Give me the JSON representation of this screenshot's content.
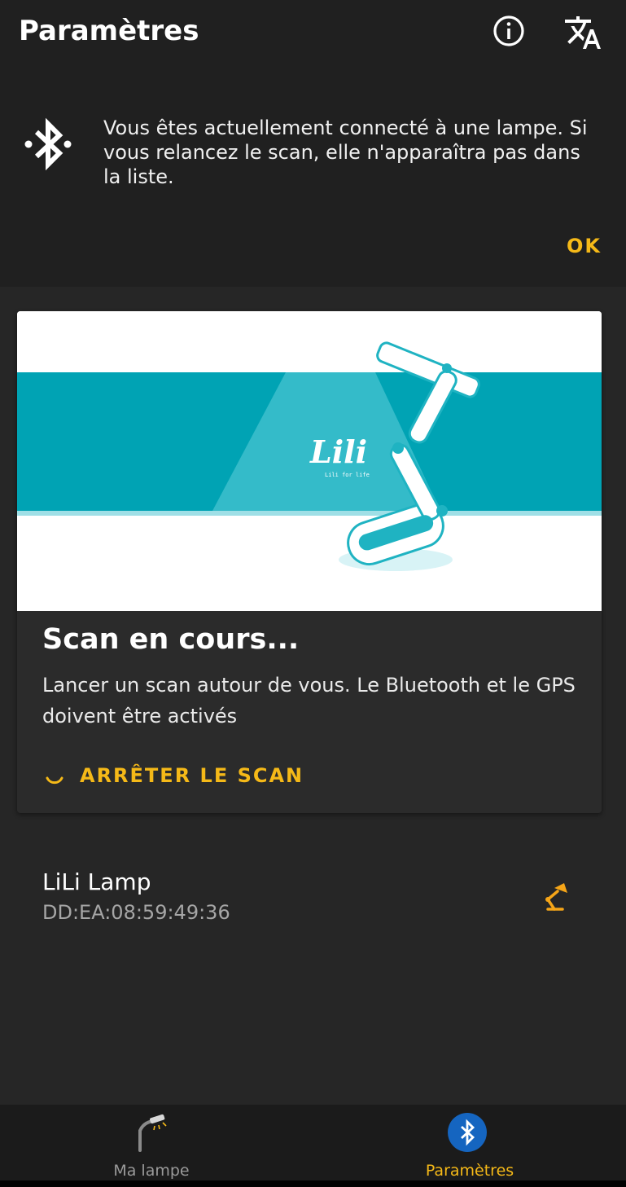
{
  "appbar": {
    "title": "Paramètres",
    "info_icon": "info-icon",
    "translate_icon": "translate-icon"
  },
  "banner": {
    "icon": "bluetooth-connected-icon",
    "message": "Vous êtes actuellement connecté à une lampe. Si vous relancez le scan, elle n'apparaîtra pas dans la liste.",
    "ok_label": "OK"
  },
  "scan_card": {
    "image": {
      "logo_text": "Lili",
      "tagline": "Lili for life"
    },
    "title": "Scan en cours...",
    "description": "Lancer un scan autour de vous. Le Bluetooth et le GPS doivent être activés",
    "stop_label": "ARRÊTER LE SCAN"
  },
  "devices": [
    {
      "name": "LiLi Lamp",
      "address": "DD:EA:08:59:49:36",
      "icon": "desk-lamp-icon"
    }
  ],
  "bottom_nav": {
    "tabs": [
      {
        "label": "Ma lampe",
        "icon": "lamp-icon",
        "active": false
      },
      {
        "label": "Paramètres",
        "icon": "bluetooth-icon",
        "active": true
      }
    ]
  },
  "colors": {
    "accent": "#f5b918",
    "background": "#262626",
    "appbar": "#202020",
    "bluetooth_blue": "#1565c0",
    "hero_teal": "#00a3b4"
  }
}
